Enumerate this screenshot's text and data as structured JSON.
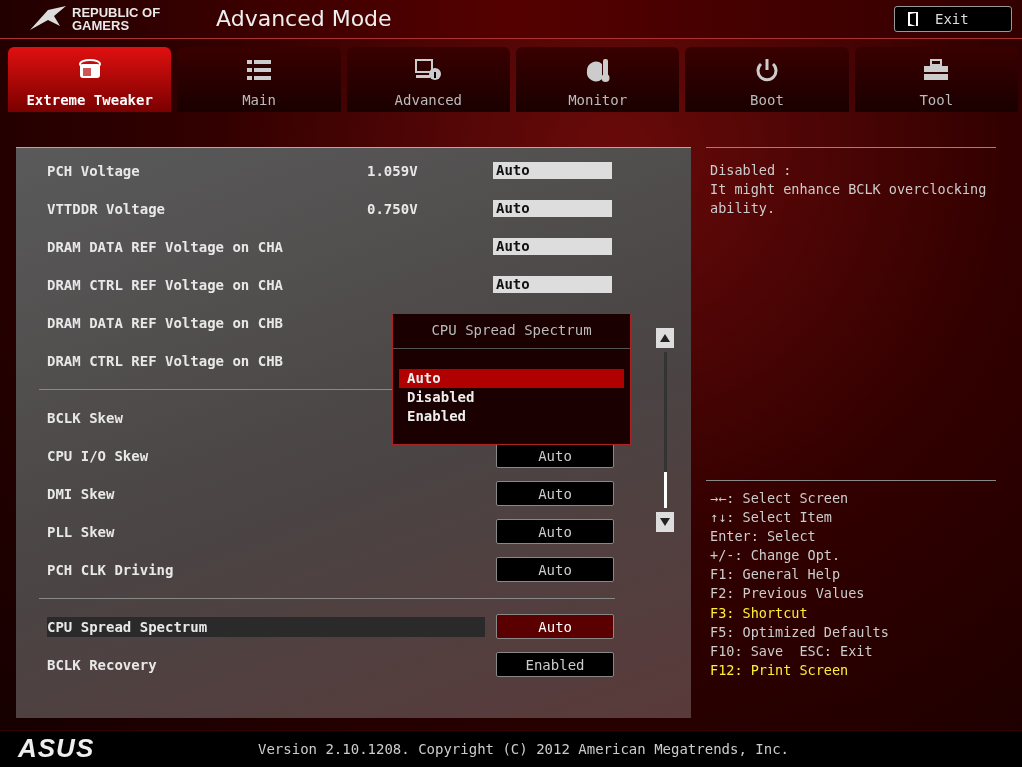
{
  "header": {
    "brand": [
      "REPUBLIC OF",
      "GAMERS"
    ],
    "title": "Advanced Mode",
    "exit_button": "Exit"
  },
  "tabs": [
    {
      "label": "Extreme Tweaker",
      "kind": "tweaker",
      "selected": true
    },
    {
      "label": "Main",
      "kind": "list",
      "selected": false
    },
    {
      "label": "Advanced",
      "kind": "advanced",
      "selected": false
    },
    {
      "label": "Monitor",
      "kind": "monitor",
      "selected": false
    },
    {
      "label": "Boot",
      "kind": "power",
      "selected": false
    },
    {
      "label": "Tool",
      "kind": "tool",
      "selected": false
    }
  ],
  "settings": [
    [
      {
        "label": "PCH Voltage",
        "reading": "1.059V",
        "kind": "field",
        "value": "Auto",
        "selected": false
      },
      {
        "label": "VTTDDR Voltage",
        "reading": "0.750V",
        "kind": "field",
        "value": "Auto",
        "selected": false
      },
      {
        "label": "DRAM DATA REF Voltage on CHA",
        "kind": "field",
        "value": "Auto",
        "selected": false
      },
      {
        "label": "DRAM CTRL REF Voltage on CHA",
        "kind": "field",
        "value": "Auto",
        "selected": false
      },
      {
        "label": "DRAM DATA REF Voltage on CHB",
        "selected": false
      },
      {
        "label": "DRAM CTRL REF Voltage on CHB",
        "selected": false
      }
    ],
    [
      {
        "label": "BCLK Skew",
        "selected": false
      },
      {
        "label": "CPU I/O Skew",
        "kind": "button",
        "value": "Auto",
        "selected": false
      },
      {
        "label": "DMI Skew",
        "kind": "button",
        "value": "Auto",
        "selected": false
      },
      {
        "label": "PLL Skew",
        "kind": "button",
        "value": "Auto",
        "selected": false
      },
      {
        "label": "PCH CLK Driving",
        "kind": "button",
        "value": "Auto",
        "selected": false
      }
    ],
    [
      {
        "label": "CPU Spread Spectrum",
        "kind": "button",
        "value": "Auto",
        "selected": true
      },
      {
        "label": "BCLK Recovery",
        "kind": "button",
        "value": "Enabled",
        "selected": false
      }
    ]
  ],
  "popup": {
    "title": "CPU Spread Spectrum",
    "options": [
      {
        "label": "Auto",
        "selected": true
      },
      {
        "label": "Disabled",
        "selected": false
      },
      {
        "label": "Enabled",
        "selected": false
      }
    ]
  },
  "help": {
    "description": [
      "Disabled :",
      "It might enhance BCLK overclocking ability."
    ],
    "keys": [
      {
        "text": "→←: Select Screen",
        "highlighted": false
      },
      {
        "text": "↑↓: Select Item",
        "highlighted": false
      },
      {
        "text": "Enter: Select",
        "highlighted": false
      },
      {
        "text": "+/-: Change Opt.",
        "highlighted": false
      },
      {
        "text": "F1: General Help",
        "highlighted": false
      },
      {
        "text": "F2: Previous Values",
        "highlighted": false
      },
      {
        "text": "F3: Shortcut",
        "highlighted": true
      },
      {
        "text": "F5: Optimized Defaults",
        "highlighted": false
      },
      {
        "text": "F10: Save  ESC: Exit",
        "highlighted": false
      },
      {
        "text": "F12: Print Screen",
        "highlighted": true
      }
    ]
  },
  "footer": {
    "brand": "ASUS",
    "version": "Version 2.10.1208. Copyright (C) 2012 American Megatrends, Inc."
  }
}
